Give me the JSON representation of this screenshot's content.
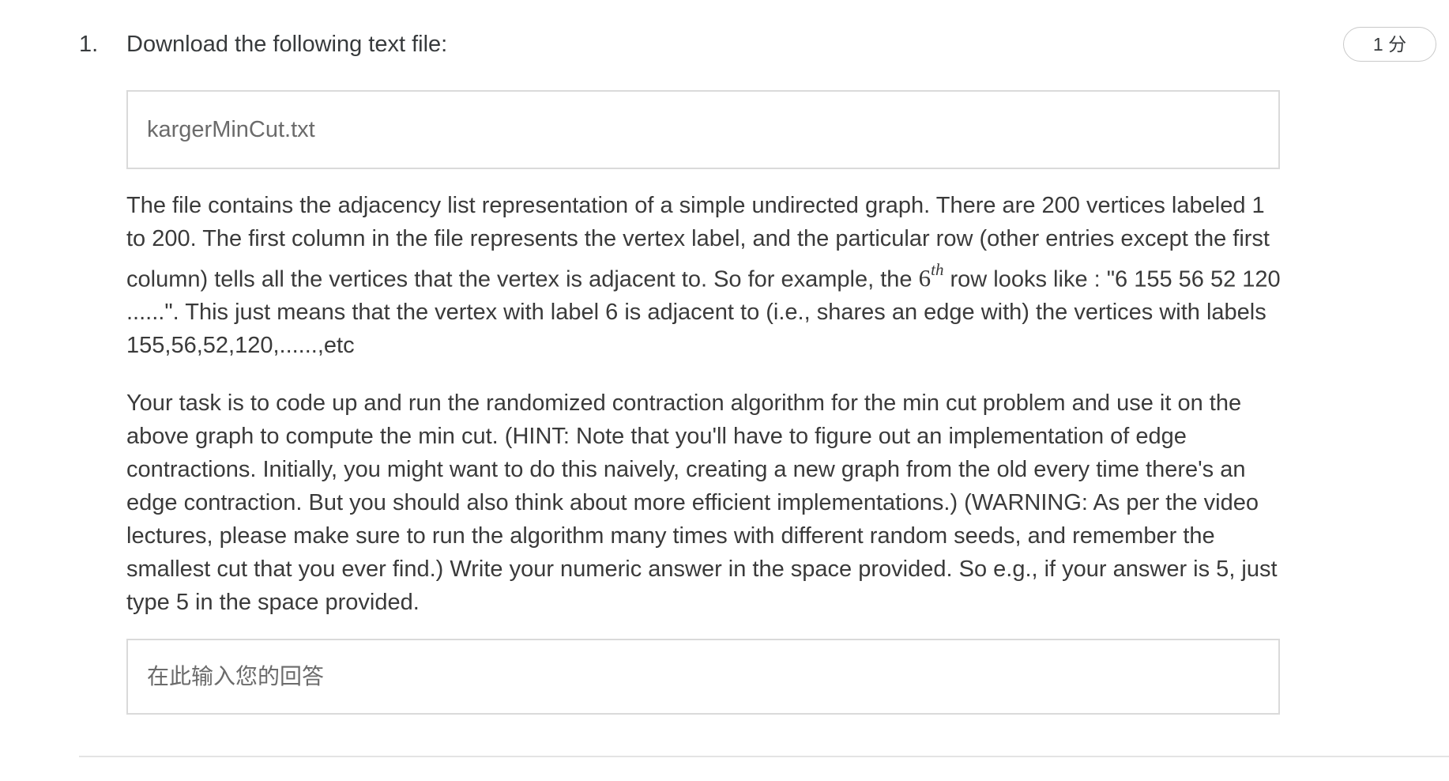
{
  "question": {
    "number": "1.",
    "prompt": "Download the following text file:",
    "points": "1 分"
  },
  "file": {
    "name": "kargerMinCut.txt"
  },
  "description": {
    "p1_before_math": "The file contains the adjacency list representation of a simple undirected graph. There are 200 vertices labeled 1 to 200. The first column in the file represents the vertex label, and the particular row (other entries except the first column) tells all the vertices that the vertex is adjacent to. So for example, the ",
    "math_base": "6",
    "math_sup": "th",
    "p1_after_math": " row looks like : \"6 155 56 52 120 ......\". This just means that the vertex with label 6 is adjacent to (i.e., shares an edge with) the vertices with labels 155,56,52,120,......,etc",
    "p2": "Your task is to code up and run the randomized contraction algorithm for the min cut problem and use it on the above graph to compute the min cut. (HINT: Note that you'll have to figure out an implementation of edge contractions. Initially, you might want to do this naively, creating a new graph from the old every time there's an edge contraction. But you should also think about more efficient implementations.) (WARNING: As per the video lectures, please make sure to run the algorithm many times with different random seeds, and remember the smallest cut that you ever find.) Write your numeric answer in the space provided. So e.g., if your answer is 5, just type 5 in the space provided."
  },
  "answer": {
    "placeholder": "在此输入您的回答",
    "value": ""
  }
}
